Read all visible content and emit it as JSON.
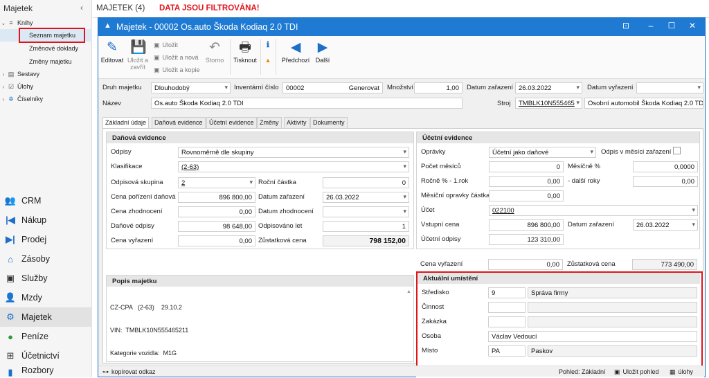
{
  "sidebar": {
    "title": "Majetek",
    "collapse_icon": "chevron-left",
    "tree": [
      {
        "label": "Knihy",
        "expanded": true
      },
      {
        "label": "Seznam majetku",
        "selected": true
      },
      {
        "label": "Změnové doklady"
      },
      {
        "label": "Změny majetku"
      },
      {
        "label": "Sestavy"
      },
      {
        "label": "Úlohy"
      },
      {
        "label": "Číselníky"
      }
    ],
    "modules": [
      {
        "label": "CRM",
        "icon": "people-icon",
        "color": "#555555"
      },
      {
        "label": "Nákup",
        "icon": "arrow-in-icon",
        "color": "#1e6fc8"
      },
      {
        "label": "Prodej",
        "icon": "arrow-out-icon",
        "color": "#1e6fc8"
      },
      {
        "label": "Zásoby",
        "icon": "home-icon",
        "color": "#1e6fc8"
      },
      {
        "label": "Služby",
        "icon": "briefcase-icon",
        "color": "#333333"
      },
      {
        "label": "Mzdy",
        "icon": "person-icon",
        "color": "#d06c12"
      },
      {
        "label": "Majetek",
        "icon": "gear-icon",
        "color": "#1e6fc8"
      },
      {
        "label": "Peníze",
        "icon": "coins-icon",
        "color": "#2a9d3a"
      },
      {
        "label": "Účetnictví",
        "icon": "calculator-icon",
        "color": "#333333"
      },
      {
        "label": "Rozbory",
        "icon": "chart-icon",
        "color": "#1e6fc8"
      }
    ]
  },
  "topbar": {
    "title": "MAJETEK (4)",
    "filter_notice": "DATA JSOU FILTROVÁNA!"
  },
  "dialog": {
    "title": "Majetek - 00002 Os.auto Škoda Kodiaq 2.0 TDI",
    "window_buttons": [
      "pin-icon",
      "minimize-icon",
      "maximize-icon",
      "close-icon"
    ],
    "ribbon": {
      "edit": "Editovat",
      "save_close": "Uložit a zavřít",
      "save": "Uložit",
      "save_new": "Uložit a nová",
      "save_copy": "Uložit a kopie",
      "cancel": "Storno",
      "print": "Tisknout",
      "prev": "Předchozí",
      "next": "Další"
    },
    "header": {
      "druh_label": "Druh majetku",
      "druh_value": "Dlouhodobý",
      "inv_label": "Inventární číslo",
      "inv_value": "00002",
      "inv_generator": "Generovat",
      "mnozstvi_label": "Množství",
      "mnozstvi_value": "1,00",
      "datum_zar_label": "Datum zařazení",
      "datum_zar_value": "26.03.2022",
      "datum_vyr_label": "Datum vyřazení",
      "datum_vyr_value": "",
      "nazev_label": "Název",
      "nazev_value": "Os.auto Škoda Kodiaq 2.0 TDI",
      "stroj_label": "Stroj",
      "stroj_value": "TMBLK10N555465",
      "stroj_desc": "Osobní automobil Škoda Kodiaq 2.0 TDI"
    },
    "tabs": [
      "Základní údaje",
      "Daňová evidence",
      "Účetní evidence",
      "Změny",
      "Aktivity",
      "Dokumenty"
    ],
    "danova": {
      "title": "Daňová evidence",
      "odpisy_label": "Odpisy",
      "odpisy_value": "Rovnoměrně dle skupiny",
      "klasifikace_label": "Klasifikace",
      "klasifikace_value": "(2-63)",
      "skupina_label": "Odpisová skupina",
      "skupina_value": "2",
      "rocni_label": "Roční částka",
      "rocni_value": "0",
      "cena_por_label": "Cena pořízení daňová",
      "cena_por_value": "896 800,00",
      "dat_zar_label": "Datum zařazení",
      "dat_zar_value": "26.03.2022",
      "cena_zhod_label": "Cena zhodnocení",
      "cena_zhod_value": "0,00",
      "dat_zhod_label": "Datum zhodnocení",
      "dat_zhod_value": "",
      "dan_odpisy_label": "Daňové odpisy",
      "dan_odpisy_value": "98 648,00",
      "odpisovano_label": "Odpisováno let",
      "odpisovano_value": "1",
      "cena_vyr_label": "Cena vyřazení",
      "cena_vyr_value": "0,00",
      "zust_label": "Zůstatková cena",
      "zust_value": "798 152,00"
    },
    "ucetni": {
      "title": "Účetní evidence",
      "opravky_label": "Oprávky",
      "opravky_value": "Účetní jako daňové",
      "odpis_mesic_label": "Odpis v měsíci zařazení",
      "pocet_label": "Počet měsíců",
      "pocet_value": "0",
      "mesicne_label": "Měsíčně %",
      "mesicne_value": "0,0000",
      "rocne_label": "Ročně % - 1.rok",
      "rocne_value": "0,00",
      "dalsi_label": "- další roky",
      "dalsi_value": "0,00",
      "mes_oprav_label": "Měsíční opravky částka",
      "mes_oprav_value": "0,00",
      "ucet_label": "Účet",
      "ucet_value": "022100",
      "vstupni_label": "Vstupní cena",
      "vstupni_value": "896 800,00",
      "datum_zar_label": "Datum zařazení",
      "datum_zar_value": "26.03.2022",
      "uc_odpisy_label": "Účetní odpisy",
      "uc_odpisy_value": "123 310,00",
      "cena_vyr_label": "Cena vyřazení",
      "cena_vyr_value": "0,00",
      "zust_label": "Zůstatková cena",
      "zust_value": "773 490,00"
    },
    "popis": {
      "title": "Popis majetku",
      "lines": [
        "CZ-CPA   (2-63)    29.10.2",
        "VIN:  TMBLK10N555465211",
        "Kategorie vozidla:  M1G"
      ]
    },
    "umisteni": {
      "title": "Aktuální umístění",
      "stredisko_label": "Středisko",
      "stredisko_code": "9",
      "stredisko_name": "Správa firmy",
      "cinnost_label": "Činnost",
      "zakazka_label": "Zakázka",
      "osoba_label": "Osoba",
      "osoba_value": "Václav Vedoucí",
      "misto_label": "Místo",
      "misto_code": "PA",
      "misto_name": "Paskov"
    },
    "status": {
      "copy_link": "kopírovat odkaz",
      "view": "Pohled: Základní",
      "save_view": "Uložit pohled",
      "tasks": "úlohy"
    }
  }
}
